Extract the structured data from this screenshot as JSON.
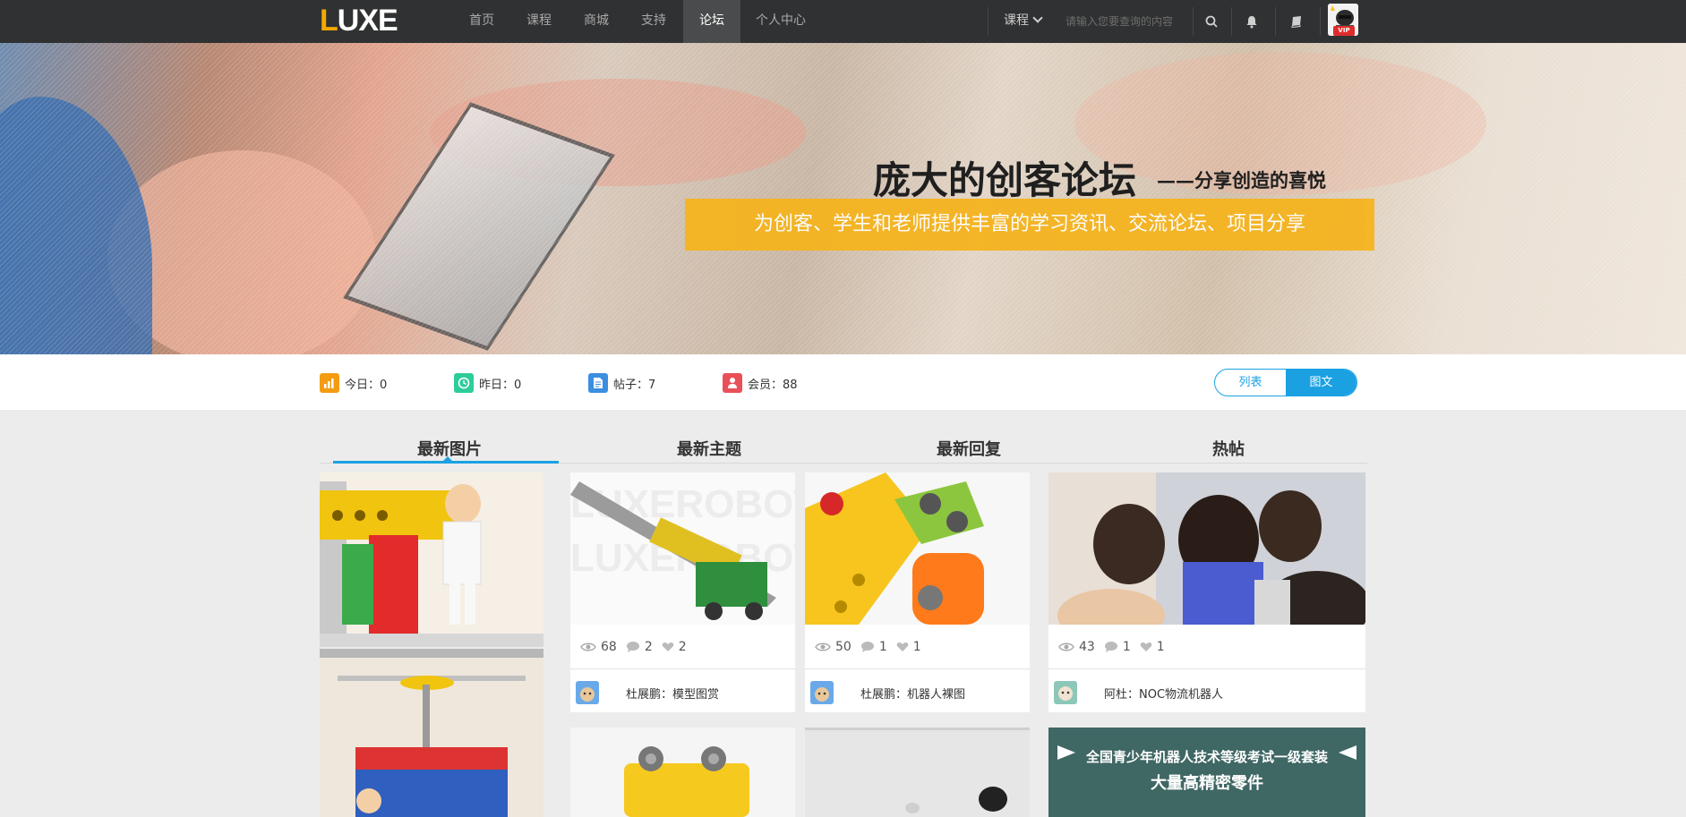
{
  "nav": {
    "logo_L": "L",
    "logo_rest": "UXE",
    "links": [
      "首页",
      "课程",
      "商城",
      "支持",
      "论坛",
      "个人中心"
    ],
    "course_dropdown": "课程",
    "search_placeholder": "请输入您要查询的内容",
    "vip_badge": "VIP",
    "icons": [
      "search-icon",
      "bell-icon",
      "book-icon"
    ]
  },
  "banner": {
    "title": "庞大的创客论坛",
    "subtitle": "——分享创造的喜悦",
    "tagline": "为创客、学生和老师提供丰富的学习资讯、交流论坛、项目分享"
  },
  "stats": {
    "today": "今日：0",
    "yesterday": "昨日：0",
    "posts": "帖子：7",
    "members": "会员：88",
    "view_list": "列表",
    "view_grid": "图文"
  },
  "tabs": [
    "最新图片",
    "最新主题",
    "最新回复",
    "热帖"
  ],
  "cards": [
    {
      "views": "68",
      "comments": "2",
      "likes": "2",
      "author_title": "杜展鹏：模型图赏"
    },
    {
      "views": "50",
      "comments": "1",
      "likes": "1",
      "author_title": "杜展鹏：机器人裸图"
    },
    {
      "views": "43",
      "comments": "1",
      "likes": "1",
      "author_title": "阿杜：NOC物流机器人"
    }
  ],
  "thumb_text": {
    "watermark_1": "LUXEROBOT",
    "watermark_2": "LUXEROBOT",
    "promo_line1": "全国青少年机器人技术等级考试一级套装",
    "promo_line2": "大量高精密零件"
  },
  "colors": {
    "accent": "#1ba1e2",
    "banner_bar": "#f5b41f",
    "navbar": "#303132"
  }
}
